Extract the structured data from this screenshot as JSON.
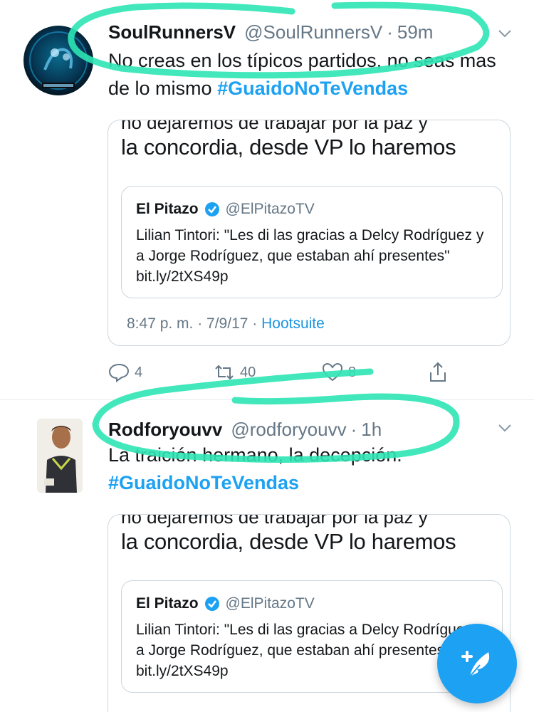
{
  "tweets": [
    {
      "display_name": "SoulRunnersV",
      "handle": "@SoulRunnersV",
      "separator": "·",
      "time": "59m",
      "text_plain": "No creas en los típicos partidos, no seas mas de lo mismo ",
      "hashtag": "#GuaidoNoTeVendas",
      "quote": {
        "cut_text": "no dejaremos de trabajar por la paz y",
        "big_text": "la concordia, desde VP lo haremos",
        "inner": {
          "name": "El Pitazo",
          "handle": "@ElPitazoTV",
          "text": "Lilian Tintori: \"Les di las gracias a Delcy Rodríguez y a Jorge Rodríguez, que estaban ahí presentes\" bit.ly/2tXS49p"
        },
        "meta_time": "8:47 p. m. · 7/9/17 · ",
        "meta_source": "Hootsuite"
      },
      "actions": {
        "reply_count": "4",
        "retweet_count": "40",
        "like_count": "8"
      }
    },
    {
      "display_name": "Rodforyouvv",
      "handle": "@rodforyouvv",
      "separator": "·",
      "time": "1h",
      "text_plain": "La traición hermano, la decepción.",
      "hashtag": "#GuaidoNoTeVendas",
      "quote": {
        "cut_text": "no dejaremos de trabajar por la paz y",
        "big_text": "la concordia, desde VP lo haremos",
        "inner": {
          "name": "El Pitazo",
          "handle": "@ElPitazoTV",
          "text": "Lilian Tintori: \"Les di las gracias a Delcy Rodríguez y a Jorge Rodríguez, que estaban ahí presentes\" bit.ly/2tXS49p"
        }
      }
    }
  ],
  "icons": {
    "caret": "chevron-down-icon",
    "verified": "verified-badge-icon",
    "reply": "reply-icon",
    "retweet": "retweet-icon",
    "like": "heart-icon",
    "share": "share-icon",
    "compose": "compose-tweet-icon"
  },
  "colors": {
    "accent": "#1da1f2",
    "marker": "#2ee6b4",
    "secondary_text": "#657786"
  }
}
